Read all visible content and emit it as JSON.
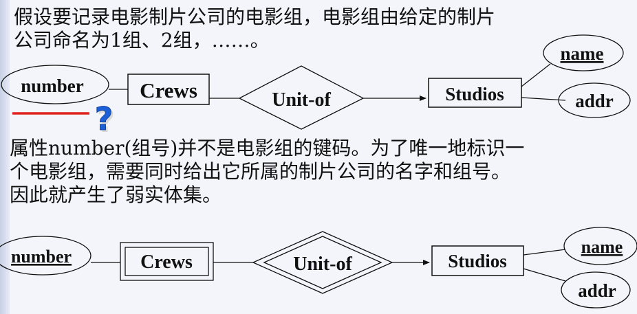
{
  "text": {
    "para1_line1": "假设要记录电影制片公司的电影组，电影组由给定的制片",
    "para1_line2": "公司命名为1组、2组，……。",
    "para2_line1": "属性number(组号)并不是电影组的键码。为了唯一地标识一",
    "para2_line2": "个电影组，需要同时给出它所属的制片公司的名字和组号。",
    "para2_line3": "因此就产生了弱实体集。"
  },
  "diagram1": {
    "attr_number": "number",
    "entity_crews": "Crews",
    "relationship": "Unit-of",
    "entity_studios": "Studios",
    "attr_name": "name",
    "attr_addr": "addr",
    "question_mark": "?"
  },
  "diagram2": {
    "attr_number": "number",
    "entity_crews": "Crews",
    "relationship": "Unit-of",
    "entity_studios": "Studios",
    "attr_name": "name",
    "attr_addr": "addr"
  },
  "colors": {
    "text": "#111111",
    "background": "#f4f4fb",
    "red_line": "#e0221c",
    "question_mark": "#1c5fd6"
  }
}
